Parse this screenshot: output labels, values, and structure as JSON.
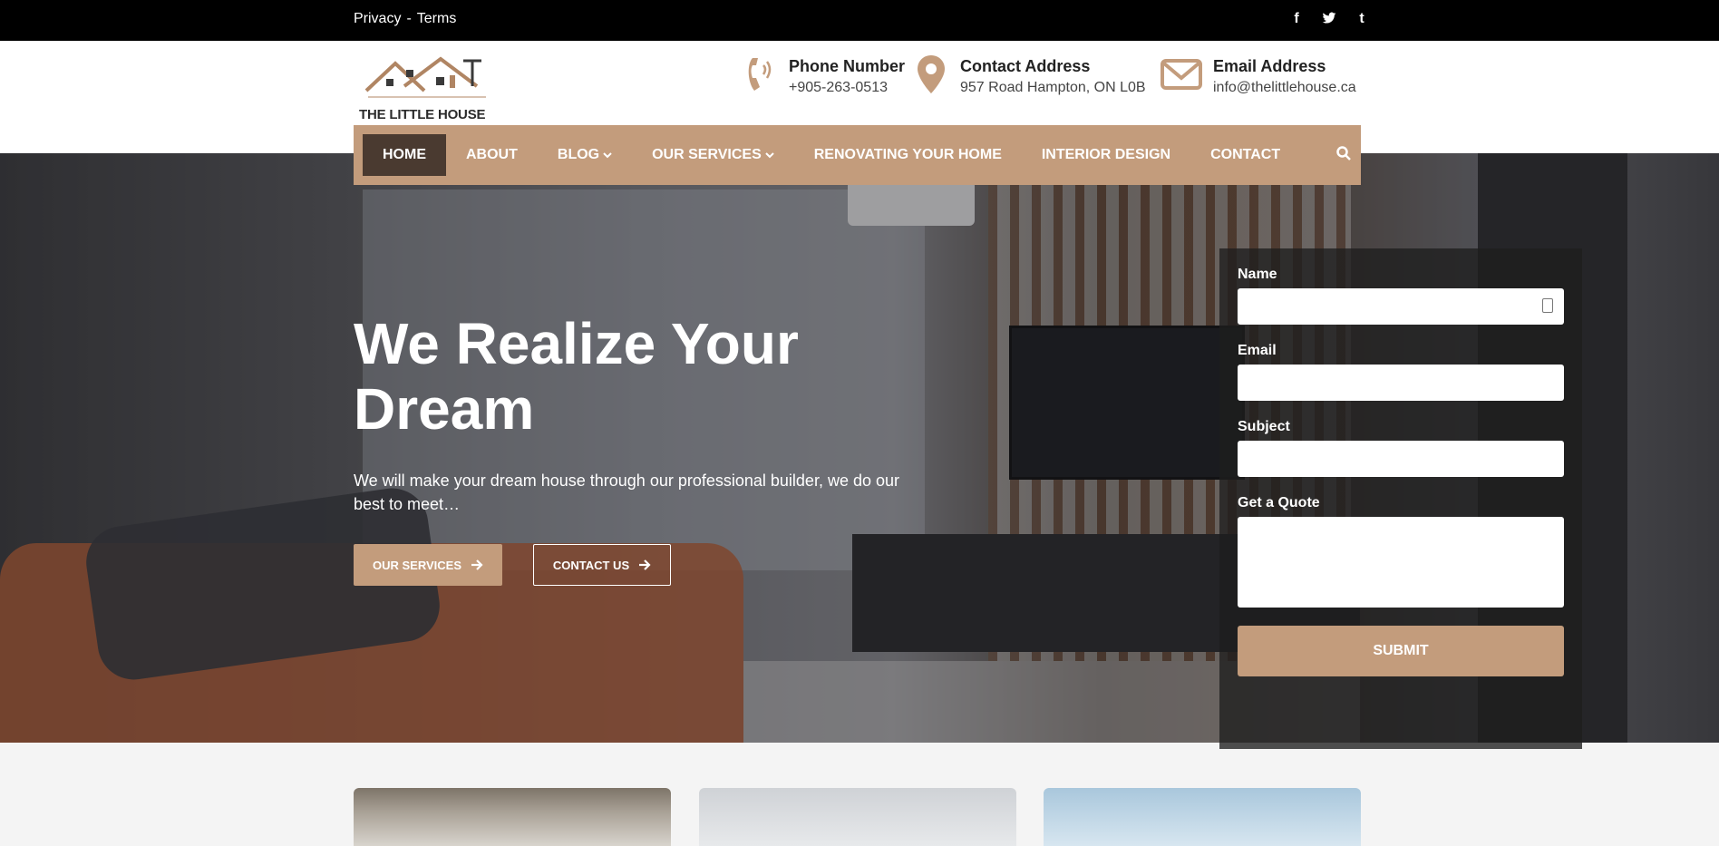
{
  "topbar": {
    "links": [
      "Privacy",
      "Terms"
    ],
    "separator": "-",
    "social": [
      {
        "icon": "facebook-icon",
        "glyph": "f"
      },
      {
        "icon": "twitter-icon",
        "glyph": "𝕥"
      },
      {
        "icon": "tumblr-icon",
        "glyph": "t"
      }
    ]
  },
  "header": {
    "logo_text": "THE LITTLE HOUSE",
    "phone": {
      "label": "Phone Number",
      "value": "+905-263-0513"
    },
    "address": {
      "label": "Contact Address",
      "value": "957 Road Hampton, ON L0B"
    },
    "email": {
      "label": "Email Address",
      "value": "info@thelittlehouse.ca"
    }
  },
  "nav": {
    "items": [
      {
        "label": "HOME",
        "active": true
      },
      {
        "label": "ABOUT"
      },
      {
        "label": "BLOG",
        "dropdown": true
      },
      {
        "label": "OUR SERVICES",
        "dropdown": true
      },
      {
        "label": "RENOVATING YOUR HOME"
      },
      {
        "label": "INTERIOR DESIGN"
      },
      {
        "label": "CONTACT"
      }
    ]
  },
  "hero": {
    "title": "We Realize Your Dream",
    "subtitle": "We will make your dream house through our professional builder, we do our best to meet…",
    "buttons": {
      "services": "OUR SERVICES",
      "contact": "CONTACT US"
    }
  },
  "form": {
    "fields": {
      "name": "Name",
      "email": "Email",
      "subject": "Subject",
      "quote": "Get a Quote"
    },
    "submit": "SUBMIT"
  },
  "colors": {
    "accent": "#c39c7c",
    "nav_active": "#4a3a30"
  }
}
